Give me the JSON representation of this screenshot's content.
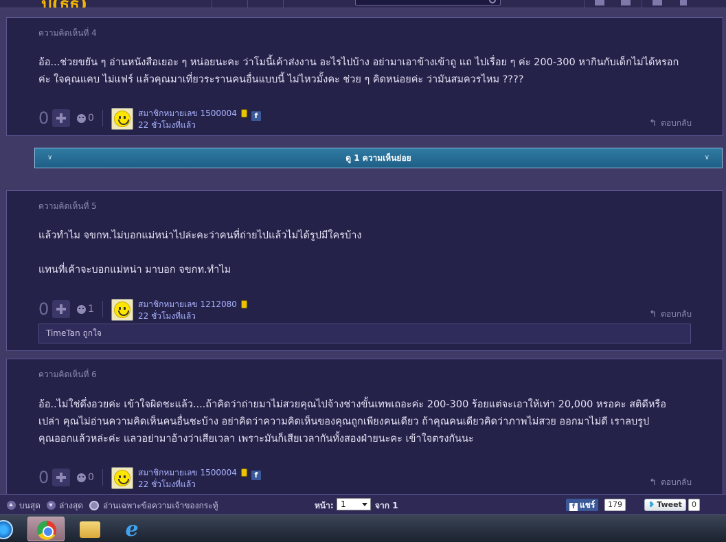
{
  "comments": [
    {
      "header": "ความคิดเห็นที่ 4",
      "lines": [
        "อ้อ...ช่วยขยัน ๆ อ่านหนังสือเยอะ ๆ หน่อยนะคะ ว่าโมนี้เค้าส่งงาน อะไรไปบ้าง อย่ามาเอาข้างเข้าถู แถ ไปเรื่อย ๆ ค่ะ 200-300 หากินกับเด็กไม่ได้หรอก",
        "ค่ะ ใจคุณแคบ ไม่แฟร์ แล้วคุณมาเที่ยวระรานคนอื่นแบบนี้ ไม่ไหวมั้งคะ ช่วย ๆ คิดหน่อยค่ะ ว่ามันสมควรไหม ????"
      ],
      "score": "0",
      "emotion_count": "0",
      "author": "สมาชิกหมายเลข 1500004",
      "time": "22 ชั่วโมงที่แล้ว",
      "reply_label": "ตอบกลับ"
    },
    {
      "header": "ความคิดเห็นที่ 5",
      "lines": [
        "แล้วทำไม จขกท.ไม่บอกแม่หน่าไปล่ะคะว่าคนที่ถ่ายไปแล้วไม่ได้รูปมีใครบ้าง",
        "แทนที่เค้าจะบอกแม่หน่า มาบอก จขกท.ทำไม"
      ],
      "score": "0",
      "emotion_count": "1",
      "author": "สมาชิกหมายเลข 1212080",
      "time": "22 ชั่วโมงที่แล้ว",
      "reply_label": "ตอบกลับ",
      "sub_reply": "TimeTan ถูกใจ"
    },
    {
      "header": "ความคิดเห็นที่ 6",
      "lines": [
        "อ้อ..ไม่ใช่ดึ่งอวยค่ะ  เข้าใจผิดชะแล้ว....ถ้าคิดว่าถ่ายมาไม่สวยคุณไปจ้างช่างขั้นเทพเถอะค่ะ 200-300 ร้อยแต่จะเอาให้เท่า 20,000 หรอคะ สติดีหรือ",
        "เปล่า  คุณไม่อ่านความคิดเห็นคนอื่นชะบ้าง  อย่าคิดว่าความคิดเห็นของคุณถูกเพียงคนเดียว ถ้าคุณคนเดียวคิดว่าภาพไม่สวย  ออกมาไม่ดี เราลบรูป",
        "คุณออกแล้วหล่ะค่ะ  แลวอย่ามาอ้างว่าเสียเวลา เพราะมันก็เสียเวลากันทั้งสองฝ่ายนะคะ  เข้าใจตรงกันนะ"
      ],
      "score": "0",
      "emotion_count": "0",
      "author": "สมาชิกหมายเลข 1500004",
      "time": "22 ชั่วโมงที่แล้ว",
      "reply_label": "ตอบกลับ"
    }
  ],
  "expand_bar": {
    "label": "ดู 1 ความเห็นย่อย",
    "left_chevron": "∨",
    "right_chevron": "∨"
  },
  "bottom_bar": {
    "top_label": "บนสุด",
    "bottom_label": "ล่างสุด",
    "owner_only_label": "อ่านเฉพาะข้อความเจ้าของกระทู้",
    "page_label": "หน้า:",
    "page_value": "1",
    "of_label": "จาก 1",
    "share_label": "แชร์",
    "share_count": "179",
    "tweet_label": "Tweet",
    "tweet_count": "0"
  },
  "colors": {
    "background": "#3f3a66",
    "card": "#25224a",
    "link": "#a9b4ff",
    "expand_bar": "#2f7aa3"
  }
}
